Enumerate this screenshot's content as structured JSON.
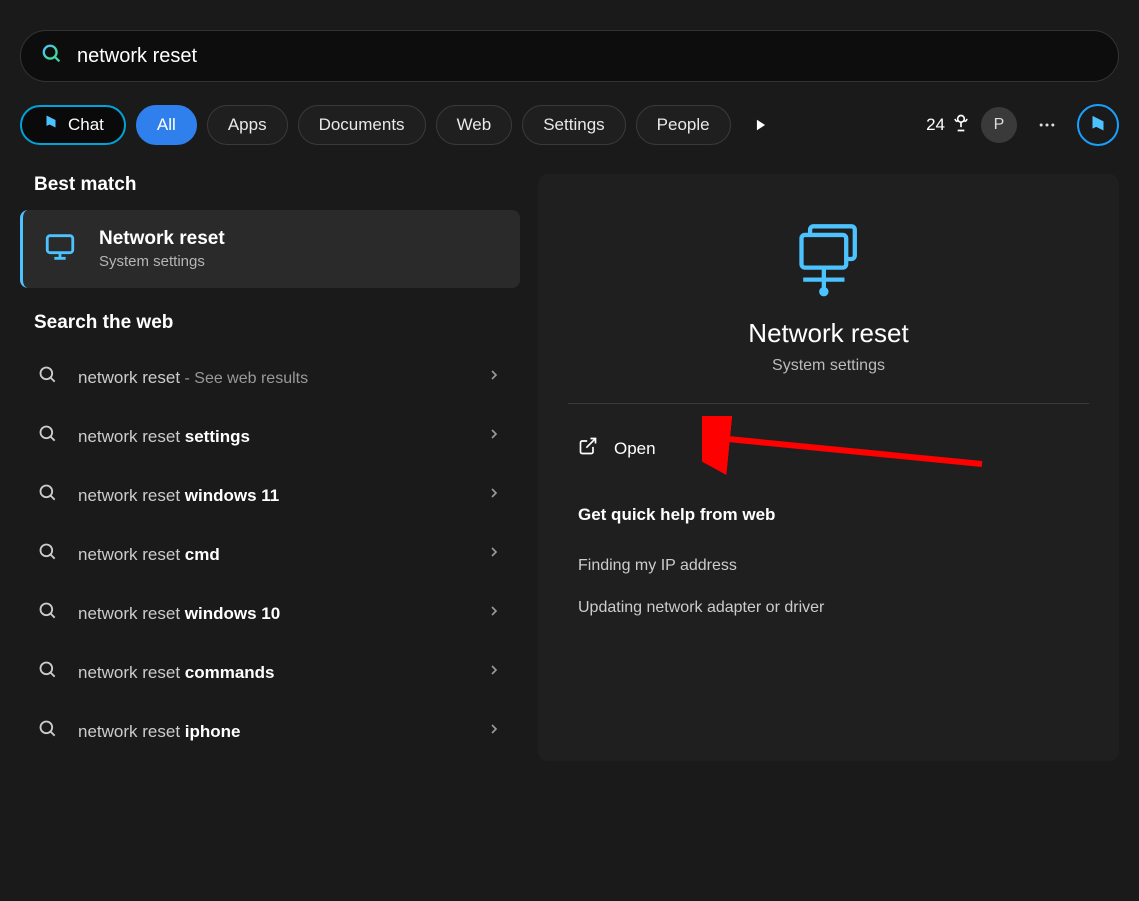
{
  "search": {
    "value": "network reset"
  },
  "filters": {
    "chat": "Chat",
    "all": "All",
    "apps": "Apps",
    "documents": "Documents",
    "web": "Web",
    "settings": "Settings",
    "people": "People"
  },
  "header": {
    "points": "24",
    "avatar": "P"
  },
  "best_match": {
    "section": "Best match",
    "title": "Network reset",
    "subtitle": "System settings"
  },
  "search_web": {
    "section": "Search the web",
    "items": [
      {
        "prefix": "network reset",
        "bold": "",
        "suffix": " - See web results"
      },
      {
        "prefix": "network reset ",
        "bold": "settings",
        "suffix": ""
      },
      {
        "prefix": "network reset ",
        "bold": "windows 11",
        "suffix": ""
      },
      {
        "prefix": "network reset ",
        "bold": "cmd",
        "suffix": ""
      },
      {
        "prefix": "network reset ",
        "bold": "windows 10",
        "suffix": ""
      },
      {
        "prefix": "network reset ",
        "bold": "commands",
        "suffix": ""
      },
      {
        "prefix": "network reset ",
        "bold": "iphone",
        "suffix": ""
      }
    ]
  },
  "panel": {
    "title": "Network reset",
    "subtitle": "System settings",
    "open": "Open",
    "help_header": "Get quick help from web",
    "help_items": [
      "Finding my IP address",
      "Updating network adapter or driver"
    ]
  }
}
